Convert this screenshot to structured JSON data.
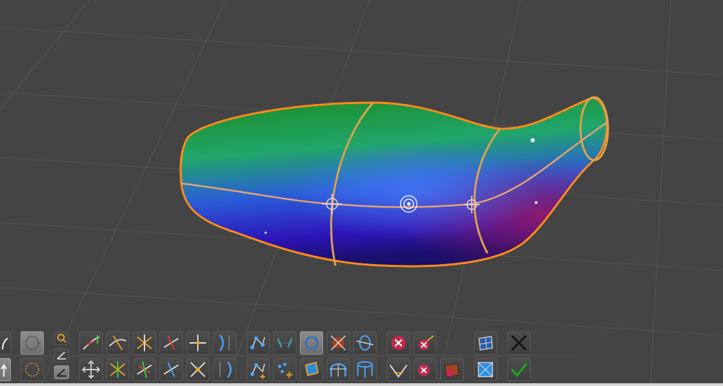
{
  "viewport": {
    "background_color": "#444444",
    "grid_color": "#575757",
    "object": {
      "name": "lofted surface",
      "outline_color": "#ff8a1a",
      "section_color": "#d7a35a",
      "gradient_colors": [
        "#1f8a1f",
        "#20b27a",
        "#2b6de0",
        "#3416c4",
        "#8a1a8a"
      ]
    }
  },
  "toolbar": {
    "rows": [
      [
        "curve-edit-icon",
        "snap-circle-icon",
        "zoom-icon",
        "tangent-arrow-icon",
        "cross-curve-icon",
        "star-cross-icon",
        "split-cross-icon",
        "point-cross-icon",
        "bracket-icon",
        "network-add-icon",
        "section-align-icon",
        "rotate-section-icon",
        "section-delete-icon",
        "cylinder-section-icon",
        "delete-circle-icon",
        "delete-tool-icon",
        "surface-grid-icon",
        "close-icon"
      ],
      [
        "curve-arrow-icon",
        "snap-dotted-icon",
        "angle-icon",
        "move-icon",
        "cross-add-icon",
        "cross-red-icon",
        "cross-blue-icon",
        "point-x-icon",
        "bracket-blue-icon",
        "network-plus-icon",
        "dots-plus-icon",
        "square-section-icon",
        "arch-icon",
        "cylinder-icon",
        "fold-icon",
        "delete-small-icon",
        "mask-delete-icon",
        "frame-icon",
        "confirm-check-icon"
      ]
    ]
  }
}
